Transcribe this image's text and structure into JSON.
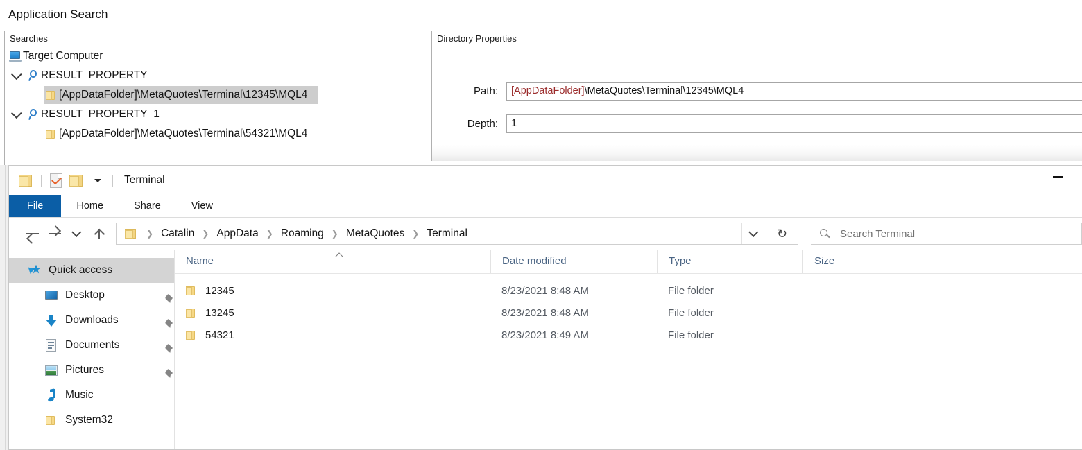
{
  "app_search": {
    "title": "Application Search",
    "searches_panel": {
      "header": "Searches",
      "tree": [
        {
          "label": "Target Computer",
          "icon": "monitor-icon",
          "level": 0,
          "twisty": false,
          "selected": false
        },
        {
          "label": "RESULT_PROPERTY",
          "icon": "magnifier-icon",
          "level": 1,
          "twisty": true,
          "selected": false
        },
        {
          "label": "[AppDataFolder]\\MetaQuotes\\Terminal\\12345\\MQL4",
          "icon": "folder-icon",
          "level": 2,
          "twisty": false,
          "selected": true
        },
        {
          "label": "RESULT_PROPERTY_1",
          "icon": "magnifier-icon",
          "level": 1,
          "twisty": true,
          "selected": false
        },
        {
          "label": "[AppDataFolder]\\MetaQuotes\\Terminal\\54321\\MQL4",
          "icon": "folder-icon",
          "level": 2,
          "twisty": false,
          "selected": false
        }
      ]
    },
    "directory_properties": {
      "header": "Directory Properties",
      "path_label": "Path:",
      "path_token": "[AppDataFolder]",
      "path_rest": "\\MetaQuotes\\Terminal\\12345\\MQL4",
      "depth_label": "Depth:",
      "depth_value": "1",
      "token_color": "#9b2c2c"
    }
  },
  "explorer": {
    "title": "Terminal",
    "quick_access_toolbar": [
      {
        "icon": "folder-icon",
        "name": "explorer-icon"
      },
      {
        "icon": "properties-icon",
        "name": "properties-button"
      },
      {
        "icon": "new-folder-icon",
        "name": "new-folder-button"
      },
      {
        "icon": "chevron-down-icon",
        "name": "customize-qat-button"
      }
    ],
    "minimize_label": "—",
    "tabs": [
      {
        "label": "File",
        "active": true
      },
      {
        "label": "Home",
        "active": false
      },
      {
        "label": "Share",
        "active": false
      },
      {
        "label": "View",
        "active": false
      }
    ],
    "nav": {
      "back": "back-button",
      "forward": "forward-button",
      "recent": "recent-locations-button",
      "up": "up-button"
    },
    "breadcrumbs": [
      "Catalin",
      "AppData",
      "Roaming",
      "MetaQuotes",
      "Terminal"
    ],
    "breadcrumb_separator": "❯",
    "address_dropdown": "chevron-down-icon",
    "refresh": "↻",
    "search": {
      "placeholder": "Search Terminal",
      "value": ""
    },
    "nav_pane": [
      {
        "label": "Quick access",
        "icon": "star-icon",
        "level": 0,
        "selected": true,
        "pinned": false
      },
      {
        "label": "Desktop",
        "icon": "desktop-icon",
        "level": 1,
        "selected": false,
        "pinned": true
      },
      {
        "label": "Downloads",
        "icon": "download-icon",
        "level": 1,
        "selected": false,
        "pinned": true
      },
      {
        "label": "Documents",
        "icon": "document-icon",
        "level": 1,
        "selected": false,
        "pinned": true
      },
      {
        "label": "Pictures",
        "icon": "picture-icon",
        "level": 1,
        "selected": false,
        "pinned": true
      },
      {
        "label": "Music",
        "icon": "music-icon",
        "level": 1,
        "selected": false,
        "pinned": false
      },
      {
        "label": "System32",
        "icon": "folder-icon",
        "level": 1,
        "selected": false,
        "pinned": false
      }
    ],
    "columns": [
      {
        "label": "Name",
        "sorted": "asc"
      },
      {
        "label": "Date modified",
        "sorted": null
      },
      {
        "label": "Type",
        "sorted": null
      },
      {
        "label": "Size",
        "sorted": null
      }
    ],
    "files": [
      {
        "name": "12345",
        "date_modified": "8/23/2021 8:48 AM",
        "type": "File folder",
        "size": ""
      },
      {
        "name": "13245",
        "date_modified": "8/23/2021 8:48 AM",
        "type": "File folder",
        "size": ""
      },
      {
        "name": "54321",
        "date_modified": "8/23/2021 8:49 AM",
        "type": "File folder",
        "size": ""
      }
    ]
  },
  "colors": {
    "accent_blue": "#0b5ea6",
    "selection_gray": "#cdcdcd",
    "nav_selection": "#d4d4d4",
    "column_header_text": "#4b6584",
    "path_token_red": "#9b2c2c"
  }
}
